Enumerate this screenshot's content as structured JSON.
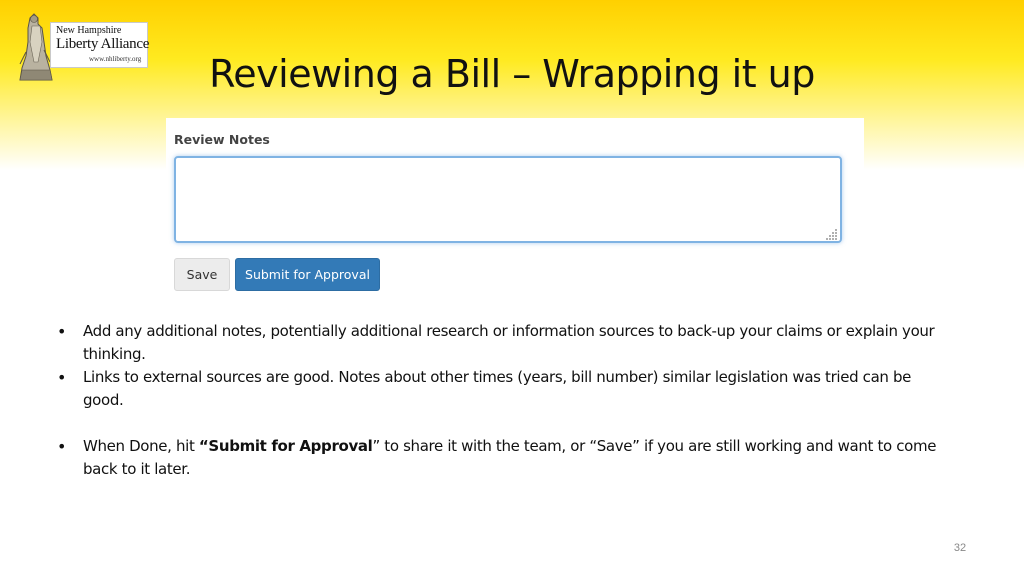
{
  "logo": {
    "line1": "New Hampshire",
    "line2": "Liberty Alliance",
    "line3": "www.nhliberty.org"
  },
  "slide": {
    "title": "Reviewing a Bill – Wrapping it up",
    "page_number": "32"
  },
  "form": {
    "review_label": "Review Notes",
    "notes_value": "",
    "save_label": "Save",
    "submit_label": "Submit for Approval"
  },
  "bullets": [
    {
      "text": "Add any additional notes, potentially additional research or information sources to back-up  your claims or explain your thinking."
    },
    {
      "text": "Links to external sources are good. Notes about other times (years, bill number) similar legislation was tried can be good."
    },
    {
      "prefix": "When Done, hit ",
      "bold": "“Submit for Approval",
      "suffix": "” to share it with the team, or “Save” if you are still working and want to come back to it later."
    }
  ],
  "colors": {
    "banner_top": "#ffd000",
    "submit_button": "#337ab7",
    "textarea_focus": "#7fb3e3"
  }
}
